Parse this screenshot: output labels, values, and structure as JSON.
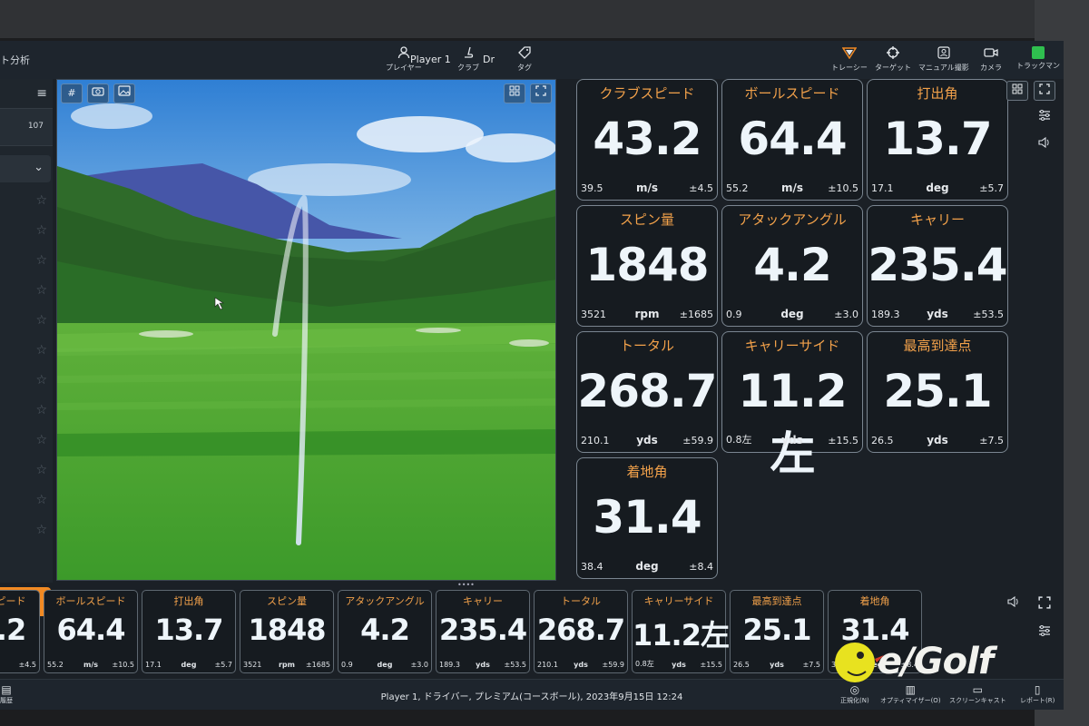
{
  "app": {
    "title_partial": "ト分析"
  },
  "topbar": {
    "player_label": "プレイヤー",
    "player_value": "Player 1",
    "club_label": "クラブ",
    "club_value": "Dr",
    "tag_label": "タグ",
    "tracer_label": "トレーシー",
    "target_label": "ターゲット",
    "manual_label": "マニュアル撮影",
    "camera_label": "カメラ",
    "trackman_label": "トラックマン"
  },
  "sidebar": {
    "shot_count": "107"
  },
  "stats": [
    {
      "title": "クラブスピード",
      "value": "43.2",
      "avg": "39.5",
      "unit": "m/s",
      "dev": "±4.5"
    },
    {
      "title": "ボールスピード",
      "value": "64.4",
      "avg": "55.2",
      "unit": "m/s",
      "dev": "±10.5"
    },
    {
      "title": "打出角",
      "value": "13.7",
      "avg": "17.1",
      "unit": "deg",
      "dev": "±5.7"
    },
    {
      "title": "スピン量",
      "value": "1848",
      "avg": "3521",
      "unit": "rpm",
      "dev": "±1685"
    },
    {
      "title": "アタックアングル",
      "value": "4.2",
      "avg": "0.9",
      "unit": "deg",
      "dev": "±3.0"
    },
    {
      "title": "キャリー",
      "value": "235.4",
      "avg": "189.3",
      "unit": "yds",
      "dev": "±53.5"
    },
    {
      "title": "トータル",
      "value": "268.7",
      "avg": "210.1",
      "unit": "yds",
      "dev": "±59.9"
    },
    {
      "title": "キャリーサイド",
      "value": "11.2左",
      "avg": "0.8左",
      "unit": "yds",
      "dev": "±15.5"
    },
    {
      "title": "最高到達点",
      "value": "25.1",
      "avg": "26.5",
      "unit": "yds",
      "dev": "±7.5"
    },
    {
      "title": "着地角",
      "value": "31.4",
      "avg": "38.4",
      "unit": "deg",
      "dev": "±8.4"
    }
  ],
  "strip": [
    {
      "title": "ピード",
      "value": ".2",
      "avg": "",
      "unit": "",
      "dev": "±4.5"
    },
    {
      "title": "ボールスピード",
      "value": "64.4",
      "avg": "55.2",
      "unit": "m/s",
      "dev": "±10.5"
    },
    {
      "title": "打出角",
      "value": "13.7",
      "avg": "17.1",
      "unit": "deg",
      "dev": "±5.7"
    },
    {
      "title": "スピン量",
      "value": "1848",
      "avg": "3521",
      "unit": "rpm",
      "dev": "±1685"
    },
    {
      "title": "アタックアングル",
      "value": "4.2",
      "avg": "0.9",
      "unit": "deg",
      "dev": "±3.0"
    },
    {
      "title": "キャリー",
      "value": "235.4",
      "avg": "189.3",
      "unit": "yds",
      "dev": "±53.5"
    },
    {
      "title": "トータル",
      "value": "268.7",
      "avg": "210.1",
      "unit": "yds",
      "dev": "±59.9"
    },
    {
      "title": "キャリーサイド",
      "value": "11.2左",
      "avg": "0.8左",
      "unit": "yds",
      "dev": "±15.5"
    },
    {
      "title": "最高到達点",
      "value": "25.1",
      "avg": "26.5",
      "unit": "yds",
      "dev": "±7.5"
    },
    {
      "title": "着地角",
      "value": "31.4",
      "avg": "38.4",
      "unit": "deg",
      "dev": "±8.4"
    }
  ],
  "statusbar": {
    "left_label": "履歴",
    "text": "Player 1, ドライバー, プレミアム(コースボール), 2023年9月15日 12:24",
    "normalize_label": "正規化(N)",
    "optimizer_label": "オプティマイザー(O)",
    "screencast_label": "スクリーンキャスト",
    "report_label": "レポート(R)"
  },
  "logo": {
    "text": "e/Golf"
  },
  "colors": {
    "accent_orange": "#f28a23",
    "title_orange": "#f2a14a",
    "trackman_green": "#2fbf4f"
  }
}
